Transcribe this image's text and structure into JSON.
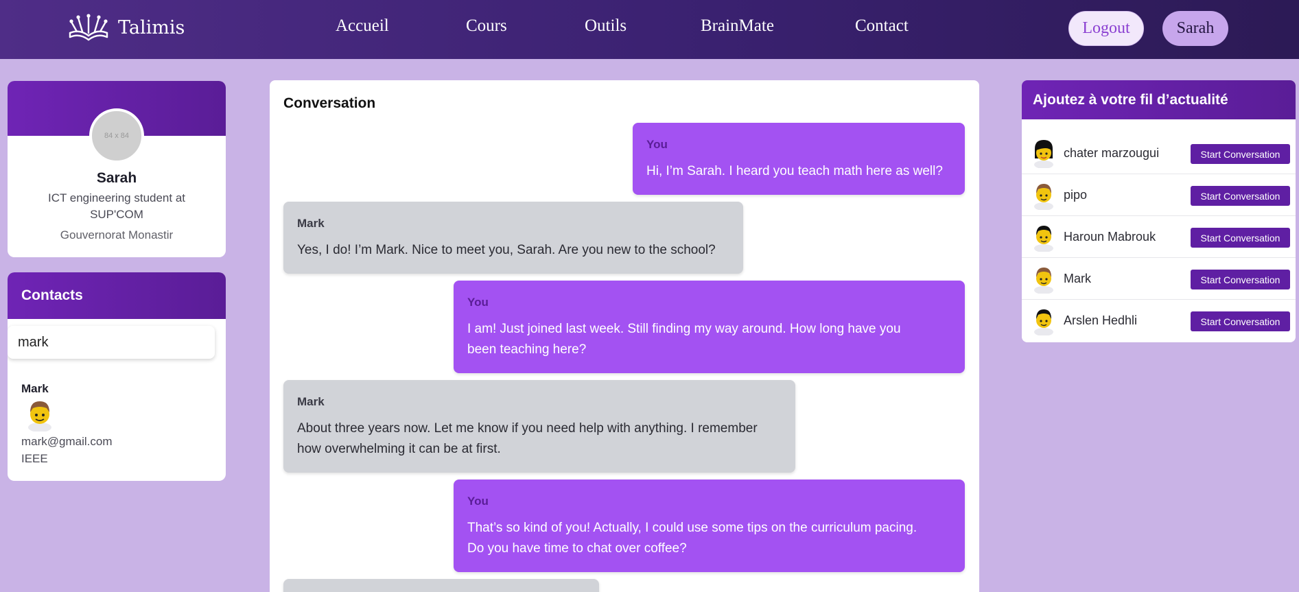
{
  "navbar": {
    "brand": "Talimis",
    "links": [
      "Accueil",
      "Cours",
      "Outils",
      "BrainMate",
      "Contact"
    ],
    "logout_label": "Logout",
    "user_label": "Sarah"
  },
  "profile": {
    "avatar_placeholder": "84 x 84",
    "name": "Sarah",
    "title": "ICT engineering student at SUP'COM",
    "location": "Gouvernorat Monastir"
  },
  "contacts": {
    "header": "Contacts",
    "search_value": "mark",
    "result": {
      "name": "Mark",
      "email": "mark@gmail.com",
      "org": "IEEE"
    }
  },
  "conversation": {
    "title": "Conversation",
    "messages": [
      {
        "sender": "You",
        "lines": [
          "Hi, I’m Sarah. I heard you teach math here as well?"
        ]
      },
      {
        "sender": "Mark",
        "lines": [
          "Yes, I do! I’m Mark. Nice to meet you, Sarah. Are you new to the school?"
        ]
      },
      {
        "sender": "You",
        "lines": [
          "I am! Just joined last week. Still finding my way around. How long have you",
          "been teaching here?"
        ]
      },
      {
        "sender": "Mark",
        "lines": [
          "About three years now. Let me know if you need help with anything. I remember",
          "how overwhelming it can be at first."
        ]
      },
      {
        "sender": "You",
        "lines": [
          "That’s so kind of you! Actually, I could use some tips on the curriculum pacing.",
          "Do you have time to chat over coffee?"
        ]
      }
    ]
  },
  "suggestions": {
    "header": "Ajoutez à votre fil d’actualité",
    "button_label": "Start Conversation",
    "people": [
      {
        "name": "chater marzougui",
        "avatar": "avatar-female-icon"
      },
      {
        "name": "pipo",
        "avatar": "avatar-male-brown-icon"
      },
      {
        "name": "Haroun Mabrouk",
        "avatar": "avatar-male-dark-icon"
      },
      {
        "name": "Mark",
        "avatar": "avatar-male-brown-icon"
      },
      {
        "name": "Arslen Hedhli",
        "avatar": "avatar-male-dark-icon"
      }
    ]
  },
  "colors": {
    "primary": "#6f24b5",
    "you_bubble": "#a352f2",
    "other_bubble": "#d1d3d8",
    "page_bg": "#c9b3e6"
  }
}
